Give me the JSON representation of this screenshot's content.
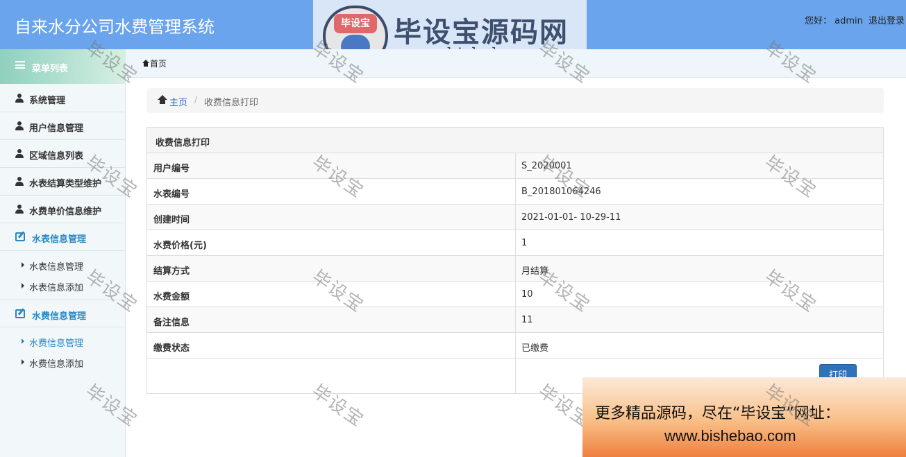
{
  "header": {
    "title": "自来水分公司水费管理系统",
    "greeting": "您好：",
    "username": "admin",
    "logout_label": "退出登录"
  },
  "logo": {
    "badge_text": "毕设宝",
    "name": "毕设宝源码网",
    "url": "www.bishebao.com"
  },
  "sidebar": {
    "menu_title": "菜单列表",
    "items": [
      {
        "label": "系统管理"
      },
      {
        "label": "用户信息管理"
      },
      {
        "label": "区域信息列表"
      },
      {
        "label": "水表结算类型维护"
      },
      {
        "label": "水费单价信息维护"
      }
    ],
    "groups": [
      {
        "label": "水表信息管理",
        "children": [
          {
            "label": "水表信息管理"
          },
          {
            "label": "水表信息添加"
          }
        ]
      },
      {
        "label": "水费信息管理",
        "children": [
          {
            "label": "水费信息管理"
          },
          {
            "label": "水费信息添加"
          }
        ]
      }
    ]
  },
  "tabbar": {
    "home_tab": "首页"
  },
  "breadcrumb": {
    "home": "主页",
    "separator": "/",
    "current": "收费信息打印"
  },
  "panel": {
    "title": "收费信息打印",
    "rows": [
      {
        "key": "用户编号",
        "value": "S_2020001"
      },
      {
        "key": "水表编号",
        "value": "B_201801064246"
      },
      {
        "key": "创建时间",
        "value": "2021-01-01- 10-29-11"
      },
      {
        "key": "水费价格(元)",
        "value": "1"
      },
      {
        "key": "结算方式",
        "value": "月结算"
      },
      {
        "key": "水费金额",
        "value": "10"
      },
      {
        "key": "备注信息",
        "value": "11"
      },
      {
        "key": "缴费状态",
        "value": "已缴费"
      }
    ],
    "print_button": "打印"
  },
  "watermark": "毕设宝",
  "promo": {
    "line1": "更多精品源码，尽在“毕设宝”网址：",
    "line2": "www.bishebao.com"
  }
}
